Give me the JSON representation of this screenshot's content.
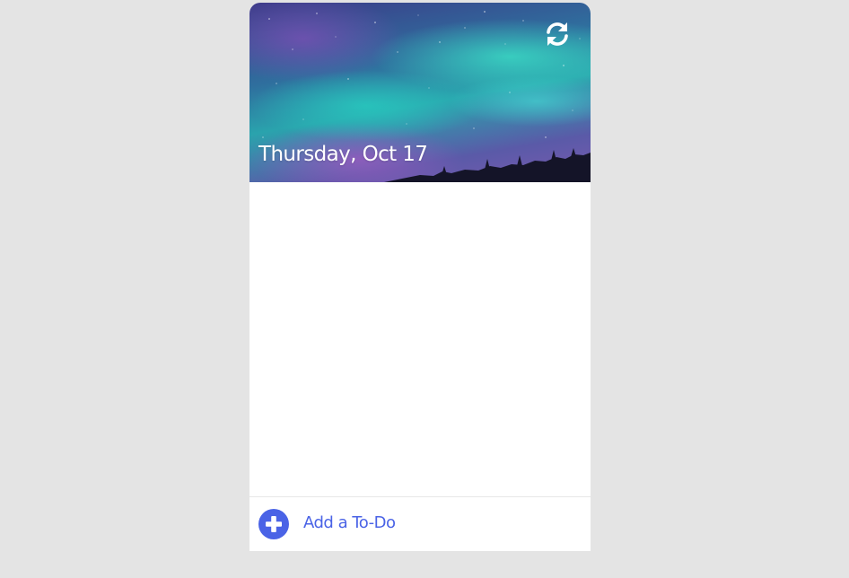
{
  "header": {
    "date": "Thursday, Oct 17",
    "refresh_icon": "refresh-icon",
    "background": "aurora-night-sky"
  },
  "todos": [],
  "footer": {
    "add_label": "Add a To-Do",
    "add_icon": "plus-circle-icon",
    "accent_color": "#4a63e6"
  }
}
